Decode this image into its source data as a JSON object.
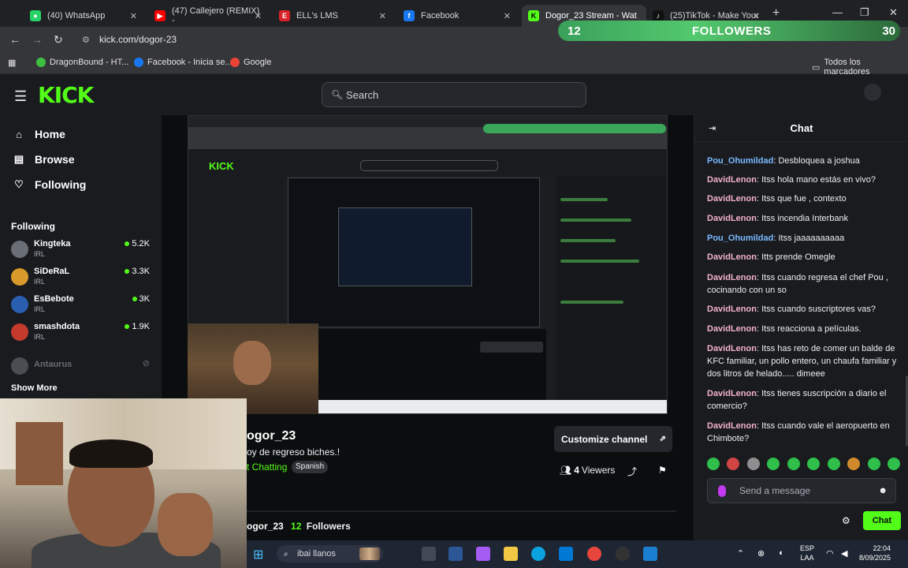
{
  "browser": {
    "tabs": [
      {
        "label": "(40) WhatsApp",
        "color": "#25d366",
        "active": false
      },
      {
        "label": "(47) Callejero (REMIX) -",
        "color": "#ff0000",
        "active": false
      },
      {
        "label": "ELL's LMS",
        "color": "#d9232a",
        "active": false
      },
      {
        "label": "Facebook",
        "color": "#1877f2",
        "active": false
      },
      {
        "label": "Dogor_23 Stream - Wat",
        "color": "#53fc18",
        "active": true
      },
      {
        "label": "(25)TikTok - Make Your",
        "color": "#111111",
        "active": false
      }
    ],
    "url": "kick.com/dogor-23",
    "bookmarks": [
      {
        "label": "DragonBound - HT...",
        "color": "#3fbf3f"
      },
      {
        "label": "Facebook - Inicia se...",
        "color": "#1877f2"
      },
      {
        "label": "Google",
        "color": "#ea4335"
      }
    ],
    "all_bookmarks_label": "Todos los marcadores"
  },
  "followers_goal": {
    "current": "12",
    "label": "FOLLOWERS",
    "target": "30"
  },
  "kick": {
    "logo": "KICK",
    "search_placeholder": "Search",
    "nav": [
      {
        "label": "Home",
        "icon": "home-icon"
      },
      {
        "label": "Browse",
        "icon": "browse-icon"
      },
      {
        "label": "Following",
        "icon": "heart-icon"
      }
    ],
    "following_heading": "Following",
    "following": [
      {
        "name": "Kingteka",
        "category": "IRL",
        "viewers": "5.2K",
        "avatar_color": "#6a6f75",
        "live": true
      },
      {
        "name": "SiDeRaL",
        "category": "IRL",
        "viewers": "3.3K",
        "avatar_color": "#d99a2b",
        "live": true
      },
      {
        "name": "EsBebote",
        "category": "IRL",
        "viewers": "3K",
        "avatar_color": "#2a5fb0",
        "live": true
      },
      {
        "name": "smashdota",
        "category": "IRL",
        "viewers": "1.9K",
        "avatar_color": "#c43a2c",
        "live": true
      },
      {
        "name": "Antaurus",
        "category": "",
        "viewers": "",
        "avatar_color": "#4a4d52",
        "live": false
      }
    ],
    "show_more": "Show More"
  },
  "channel": {
    "name": "dogor_23",
    "name_visible": "ogor_23",
    "title": "oy de regreso biches.!",
    "category": "t Chatting",
    "language": "Spanish",
    "customize_label": "Customize channel",
    "viewers_count": "4",
    "viewers_label": "Viewers",
    "about_name": "ogor_23",
    "followers_count": "12",
    "followers_label": "Followers"
  },
  "chat": {
    "title": "Chat",
    "messages": [
      {
        "user": "Pou_Ohumildad",
        "text": "Desbloquea a joshua",
        "color": "blue"
      },
      {
        "user": "DavidLenon",
        "text": "Itss hola mano estás en vivo?",
        "color": "pink"
      },
      {
        "user": "DavidLenon",
        "text": "Itss que fue , contexto",
        "color": "pink"
      },
      {
        "user": "DavidLenon",
        "text": "Itss incendia Interbank",
        "color": "pink"
      },
      {
        "user": "Pou_Ohumildad",
        "text": "Itss jaaaaaaaaaa",
        "color": "blue"
      },
      {
        "user": "DavidLenon",
        "text": "Itts prende Omegle",
        "color": "pink"
      },
      {
        "user": "DavidLenon",
        "text": "Itss cuando regresa el chef Pou , cocinando con un so",
        "color": "pink"
      },
      {
        "user": "DavidLenon",
        "text": "Itss cuando suscriptores vas?",
        "color": "pink"
      },
      {
        "user": "DavidLenon",
        "text": "Itss reacciona a películas.",
        "color": "pink"
      },
      {
        "user": "DavidLenon",
        "text": "Itss has reto de comer un balde de KFC familiar, un pollo entero, un chaufa familiar y dos litros de helado..... dimeee",
        "color": "pink"
      },
      {
        "user": "DavidLenon",
        "text": "Itss tienes suscripción a diario el comercio?",
        "color": "pink"
      },
      {
        "user": "DavidLenon",
        "text": "Itss cuando vale el aeropuerto en Chimbote?",
        "color": "pink"
      }
    ],
    "input_placeholder": "Send a message",
    "send_label": "Chat"
  },
  "taskbar": {
    "search_text": "ibai llanos",
    "lang_top": "ESP",
    "lang_bottom": "LAA",
    "time": "22:04",
    "date": "8/09/2025"
  }
}
